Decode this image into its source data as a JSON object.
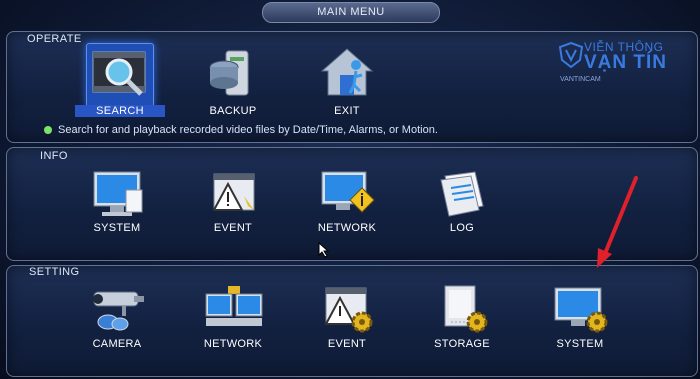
{
  "window": {
    "title": "MAIN MENU"
  },
  "operate": {
    "label": "OPERATE",
    "items": [
      {
        "label": "SEARCH",
        "icon": "search-icon",
        "selected": true
      },
      {
        "label": "BACKUP",
        "icon": "backup-icon"
      },
      {
        "label": "EXIT",
        "icon": "exit-icon"
      }
    ],
    "tip": "Search for and playback recorded video files by Date/Time, Alarms, or Motion."
  },
  "info": {
    "label": "INFO",
    "items": [
      {
        "label": "SYSTEM",
        "icon": "system-info-icon"
      },
      {
        "label": "EVENT",
        "icon": "event-warning-icon"
      },
      {
        "label": "NETWORK",
        "icon": "network-info-icon"
      },
      {
        "label": "LOG",
        "icon": "log-icon"
      }
    ]
  },
  "setting": {
    "label": "SETTING",
    "items": [
      {
        "label": "CAMERA",
        "icon": "camera-icon"
      },
      {
        "label": "NETWORK",
        "icon": "network-monitors-icon"
      },
      {
        "label": "EVENT",
        "icon": "event-settings-icon"
      },
      {
        "label": "STORAGE",
        "icon": "storage-icon"
      },
      {
        "label": "SYSTEM",
        "icon": "system-settings-icon"
      }
    ]
  },
  "watermark": {
    "line1": "VIỄN THÔNG",
    "line2": "VẠN TÍN",
    "line3": "VANTINCAM"
  },
  "colors": {
    "selection": "#2a55c4",
    "panel": "#1d2f55",
    "annotation_arrow": "#e0202a"
  }
}
